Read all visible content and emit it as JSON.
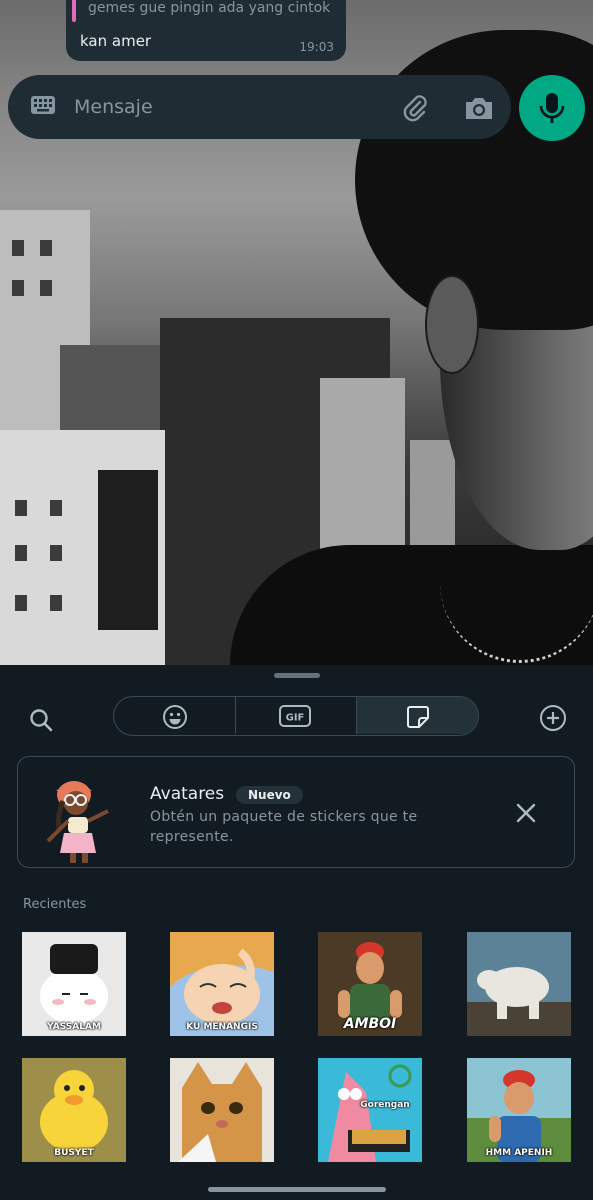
{
  "chat": {
    "quoted_text": "gemes gue pingin ada yang cintok",
    "message": "kan amer",
    "time": "19:03"
  },
  "composer": {
    "placeholder": "Mensaje",
    "icons": [
      "keyboard-icon",
      "attach-icon",
      "camera-icon",
      "mic-icon"
    ],
    "accent": "#00a884"
  },
  "panel": {
    "tabs": [
      "emoji-tab",
      "gif-tab",
      "sticker-tab"
    ],
    "selected_tab": "sticker-tab",
    "gif_label": "GIF"
  },
  "avatar_card": {
    "title": "Avatares",
    "badge": "Nuevo",
    "description": "Obtén un paquete de stickers que te represente."
  },
  "recent": {
    "label": "Recientes",
    "stickers": [
      {
        "caption": "YASSALAM"
      },
      {
        "caption": "KU MENANGIS"
      },
      {
        "caption": "AMBOI"
      },
      {
        "caption": ""
      },
      {
        "caption": "BUSYET"
      },
      {
        "caption": ""
      },
      {
        "caption": "Gorengan"
      },
      {
        "caption": "HMM APENIH"
      }
    ]
  }
}
